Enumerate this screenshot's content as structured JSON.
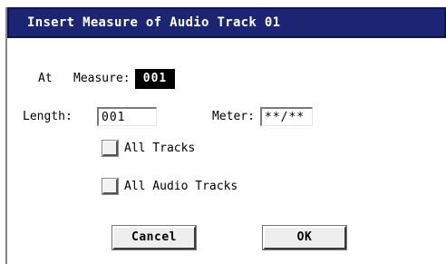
{
  "dialog": {
    "title": "Insert Measure of Audio Track 01",
    "at_label": "At",
    "measure_label": "Measure:",
    "measure_value": "001",
    "length_label": "Length:",
    "length_value": "001",
    "meter_label": "Meter:",
    "meter_value": "**/**",
    "all_tracks_label": "All Tracks",
    "all_tracks_checked": false,
    "all_audio_tracks_label": "All Audio Tracks",
    "all_audio_tracks_checked": false,
    "cancel_label": "Cancel",
    "ok_label": "OK"
  }
}
